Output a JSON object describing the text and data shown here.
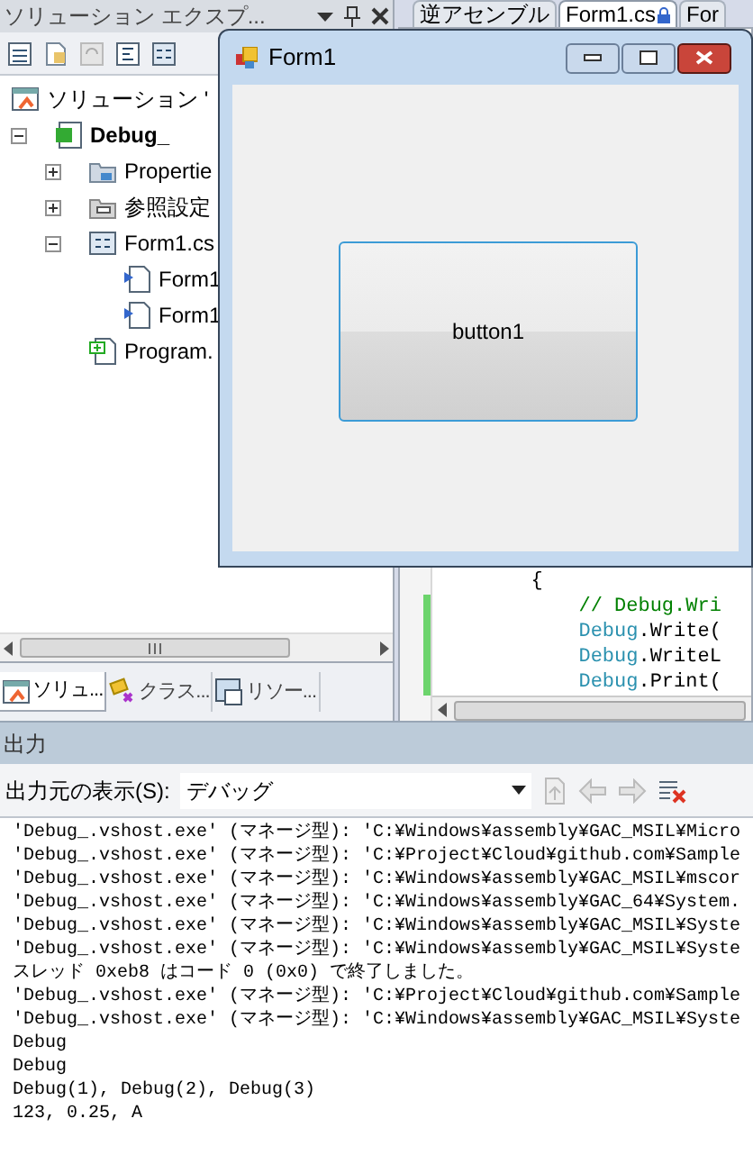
{
  "solution_explorer": {
    "title": "ソリューション エクスプ...",
    "tree": [
      {
        "label": "ソリューション '",
        "kind": "solution",
        "bold": false,
        "children": [
          {
            "label": "Debug_",
            "kind": "project",
            "bold": true,
            "expanded": true,
            "children": [
              {
                "label": "Propertie",
                "kind": "properties",
                "bold": false,
                "expanded": false
              },
              {
                "label": "参照設定",
                "kind": "references",
                "bold": false,
                "expanded": false
              },
              {
                "label": "Form1.cs",
                "kind": "form",
                "bold": false,
                "expanded": true,
                "children": [
                  {
                    "label": "Form1",
                    "kind": "designer",
                    "bold": false
                  },
                  {
                    "label": "Form1",
                    "kind": "designer",
                    "bold": false
                  }
                ]
              },
              {
                "label": "Program.",
                "kind": "csharp",
                "bold": false
              }
            ]
          }
        ]
      }
    ],
    "bottom_tabs": [
      {
        "label": "ソリュ...",
        "kind": "solution",
        "selected": true
      },
      {
        "label": "クラス...",
        "kind": "class",
        "selected": false
      },
      {
        "label": "リソー...",
        "kind": "resource",
        "selected": false
      }
    ]
  },
  "editor_tabs": [
    {
      "label": "逆アセンブル",
      "selected": false,
      "locked": false
    },
    {
      "label": "Form1.cs",
      "selected": true,
      "locked": true
    },
    {
      "label": "For",
      "selected": false,
      "locked": false
    }
  ],
  "code_lines": [
    {
      "changed": false,
      "segments": [
        {
          "text": "        {",
          "kind": "plain"
        }
      ]
    },
    {
      "changed": true,
      "segments": [
        {
          "text": "            // Debug.Wri",
          "kind": "comment"
        }
      ]
    },
    {
      "changed": true,
      "segments": [
        {
          "text": "            Debug",
          "kind": "type"
        },
        {
          "text": ".Write(",
          "kind": "plain"
        }
      ]
    },
    {
      "changed": true,
      "segments": [
        {
          "text": "            Debug",
          "kind": "type"
        },
        {
          "text": ".WriteL",
          "kind": "plain"
        }
      ]
    },
    {
      "changed": true,
      "segments": [
        {
          "text": "            Debug",
          "kind": "type"
        },
        {
          "text": ".Print(",
          "kind": "plain"
        }
      ]
    }
  ],
  "form_window": {
    "title": "Form1",
    "button": "button1"
  },
  "output": {
    "title": "出力",
    "source_label": "出力元の表示(S):",
    "source_value": "デバッグ",
    "lines": [
      "'Debug_.vshost.exe' (マネージ型): 'C:¥Windows¥assembly¥GAC_MSIL¥Micro",
      "'Debug_.vshost.exe' (マネージ型): 'C:¥Project¥Cloud¥github.com¥Sample",
      "'Debug_.vshost.exe' (マネージ型): 'C:¥Windows¥assembly¥GAC_MSIL¥mscor",
      "'Debug_.vshost.exe' (マネージ型): 'C:¥Windows¥assembly¥GAC_64¥System.",
      "'Debug_.vshost.exe' (マネージ型): 'C:¥Windows¥assembly¥GAC_MSIL¥Syste",
      "'Debug_.vshost.exe' (マネージ型): 'C:¥Windows¥assembly¥GAC_MSIL¥Syste",
      "スレッド 0xeb8 はコード 0 (0x0) で終了しました。",
      "'Debug_.vshost.exe' (マネージ型): 'C:¥Project¥Cloud¥github.com¥Sample",
      "'Debug_.vshost.exe' (マネージ型): 'C:¥Windows¥assembly¥GAC_MSIL¥Syste",
      "Debug",
      "Debug",
      "Debug(1), Debug(2), Debug(3)",
      "123, 0.25, A"
    ]
  }
}
